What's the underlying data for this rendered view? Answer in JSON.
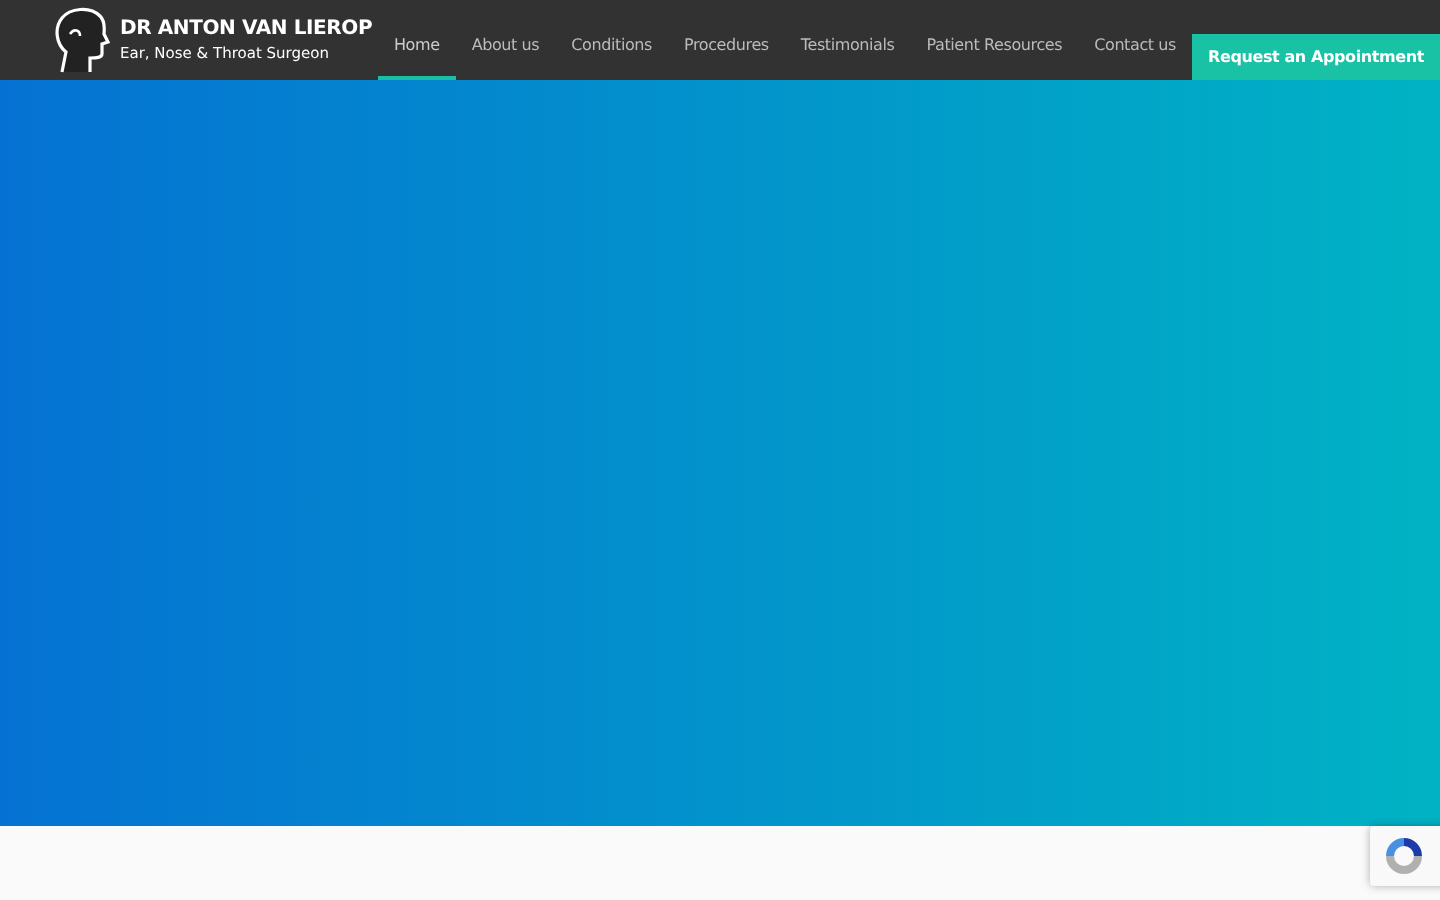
{
  "brand": {
    "name": "DR ANTON VAN LIEROP",
    "tagline": "Ear, Nose & Throat Surgeon"
  },
  "nav": [
    {
      "label": "Home",
      "selected": true
    },
    {
      "label": "About us",
      "selected": false
    },
    {
      "label": "Conditions",
      "selected": false
    },
    {
      "label": "Procedures",
      "selected": false
    },
    {
      "label": "Testimonials",
      "selected": false
    },
    {
      "label": "Patient Resources",
      "selected": false
    },
    {
      "label": "Contact us",
      "selected": false
    }
  ],
  "cta": {
    "label": "Request an Appointment"
  }
}
